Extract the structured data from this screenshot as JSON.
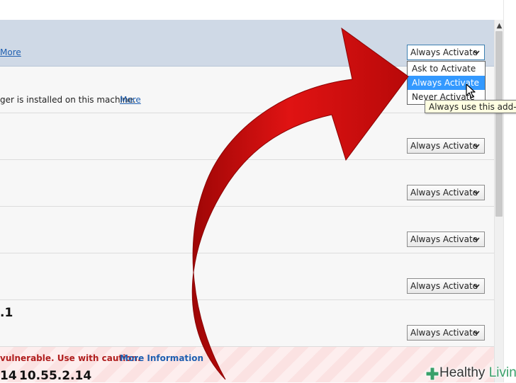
{
  "addons": [
    {
      "link": "More",
      "dropdown_value": "Always Activate"
    },
    {
      "description": "ger is installed on this machine.",
      "link": "More"
    },
    {
      "dropdown_value": "Always Activate"
    },
    {
      "dropdown_value": "Always Activate"
    },
    {
      "dropdown_value": "Always Activate"
    },
    {
      "dropdown_value": "Always Activate"
    },
    {
      "version": ".1",
      "dropdown_value": "Always Activate"
    },
    {
      "warning": "vulnerable. Use with caution.",
      "link": "More Information",
      "version_a": "14",
      "version_b": "10.55.2.14"
    }
  ],
  "dropdown_menu": {
    "options": [
      "Ask to Activate",
      "Always Activate",
      "Never Activate"
    ],
    "highlighted": "Always Activate"
  },
  "tooltip": "Always use this add-on",
  "watermark": {
    "part1": "Healthy",
    "part2": " Living"
  },
  "colors": {
    "arrow": "#d40c0c",
    "highlight": "#3399ff",
    "link": "#1f5fb0",
    "selected_row": "#cfd9e6"
  },
  "icons": [
    "chevron-down-icon",
    "scroll-up-icon",
    "mouse-pointer-icon",
    "curved-arrow-icon",
    "plus-cross-icon"
  ]
}
